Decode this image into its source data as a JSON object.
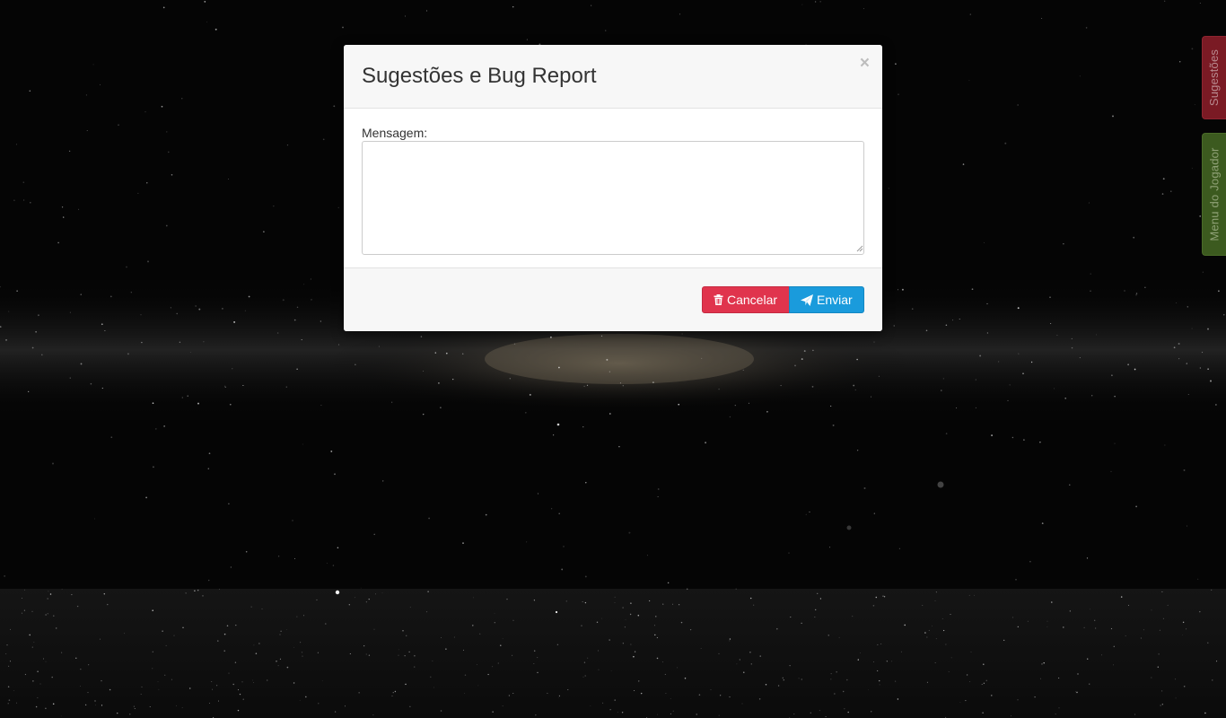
{
  "side_tabs": {
    "suggestions_label": "Sugestões",
    "player_menu_label": "Menu do Jogador"
  },
  "modal": {
    "title": "Sugestões e Bug Report",
    "close_glyph": "×",
    "message_label": "Mensagem:",
    "message_value": "",
    "cancel_label": "Cancelar",
    "send_label": "Enviar",
    "cancel_icon": "trash-icon",
    "send_icon": "paper-plane-icon"
  },
  "colors": {
    "cancel": "#e0344d",
    "send": "#1a9bdc",
    "suggestions_tab": "#7a1a24",
    "player_menu_tab": "#3c5a1f"
  }
}
